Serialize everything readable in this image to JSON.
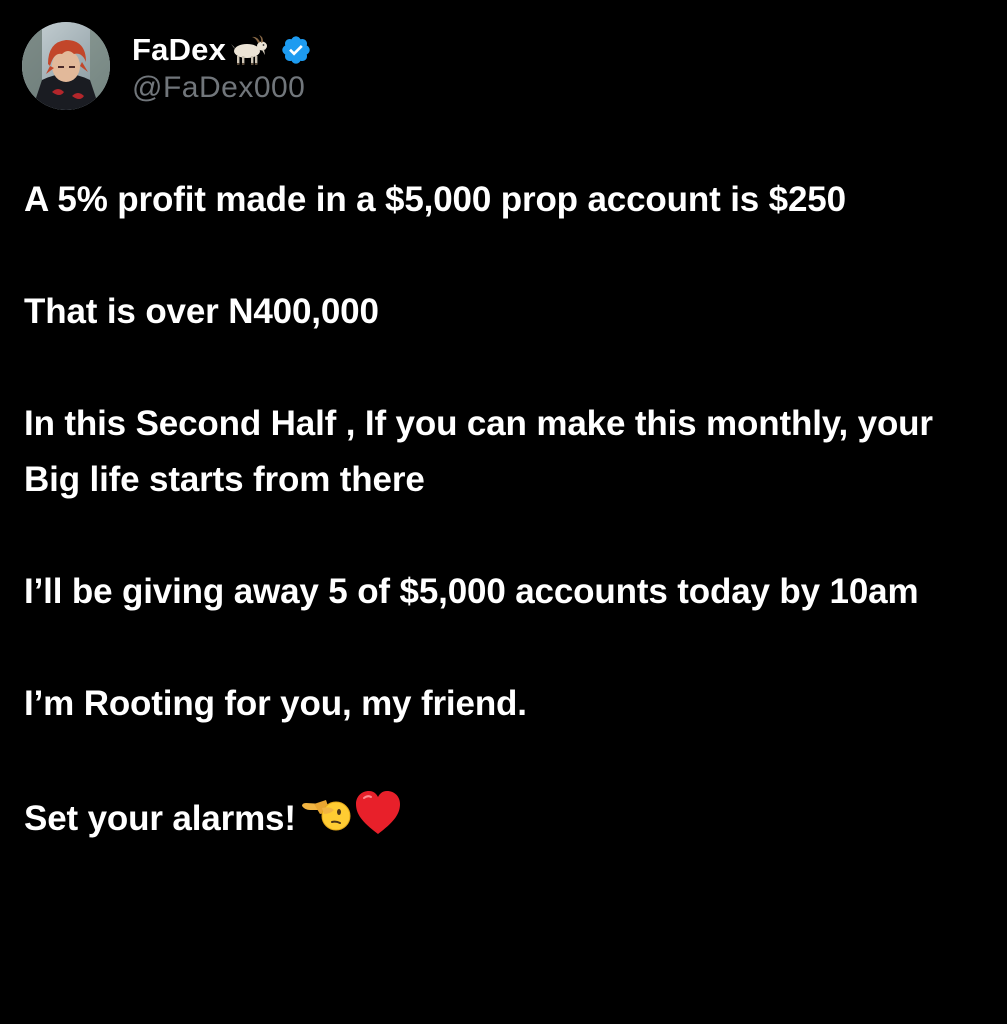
{
  "post": {
    "author": {
      "display_name": "FaDex",
      "handle": "@FaDex000",
      "name_emoji_icon": "goat-icon",
      "verified_icon": "verified-badge-icon",
      "verified_color": "#1d9bf0"
    },
    "paragraphs": [
      "A 5% profit made in a $5,000 prop account is $250",
      "That is over N400,000",
      "In this Second Half , If you can make this monthly, your Big life starts from there",
      "I’ll be giving away 5 of $5,000 accounts today by 10am",
      "I’m Rooting for you, my friend."
    ],
    "closing_text": "Set your alarms!",
    "closing_emoji_icons": [
      "pointing-face-icon",
      "red-heart-icon"
    ]
  },
  "theme": {
    "background": "#000000",
    "text": "#ffffff",
    "secondary_text": "#71767b"
  }
}
